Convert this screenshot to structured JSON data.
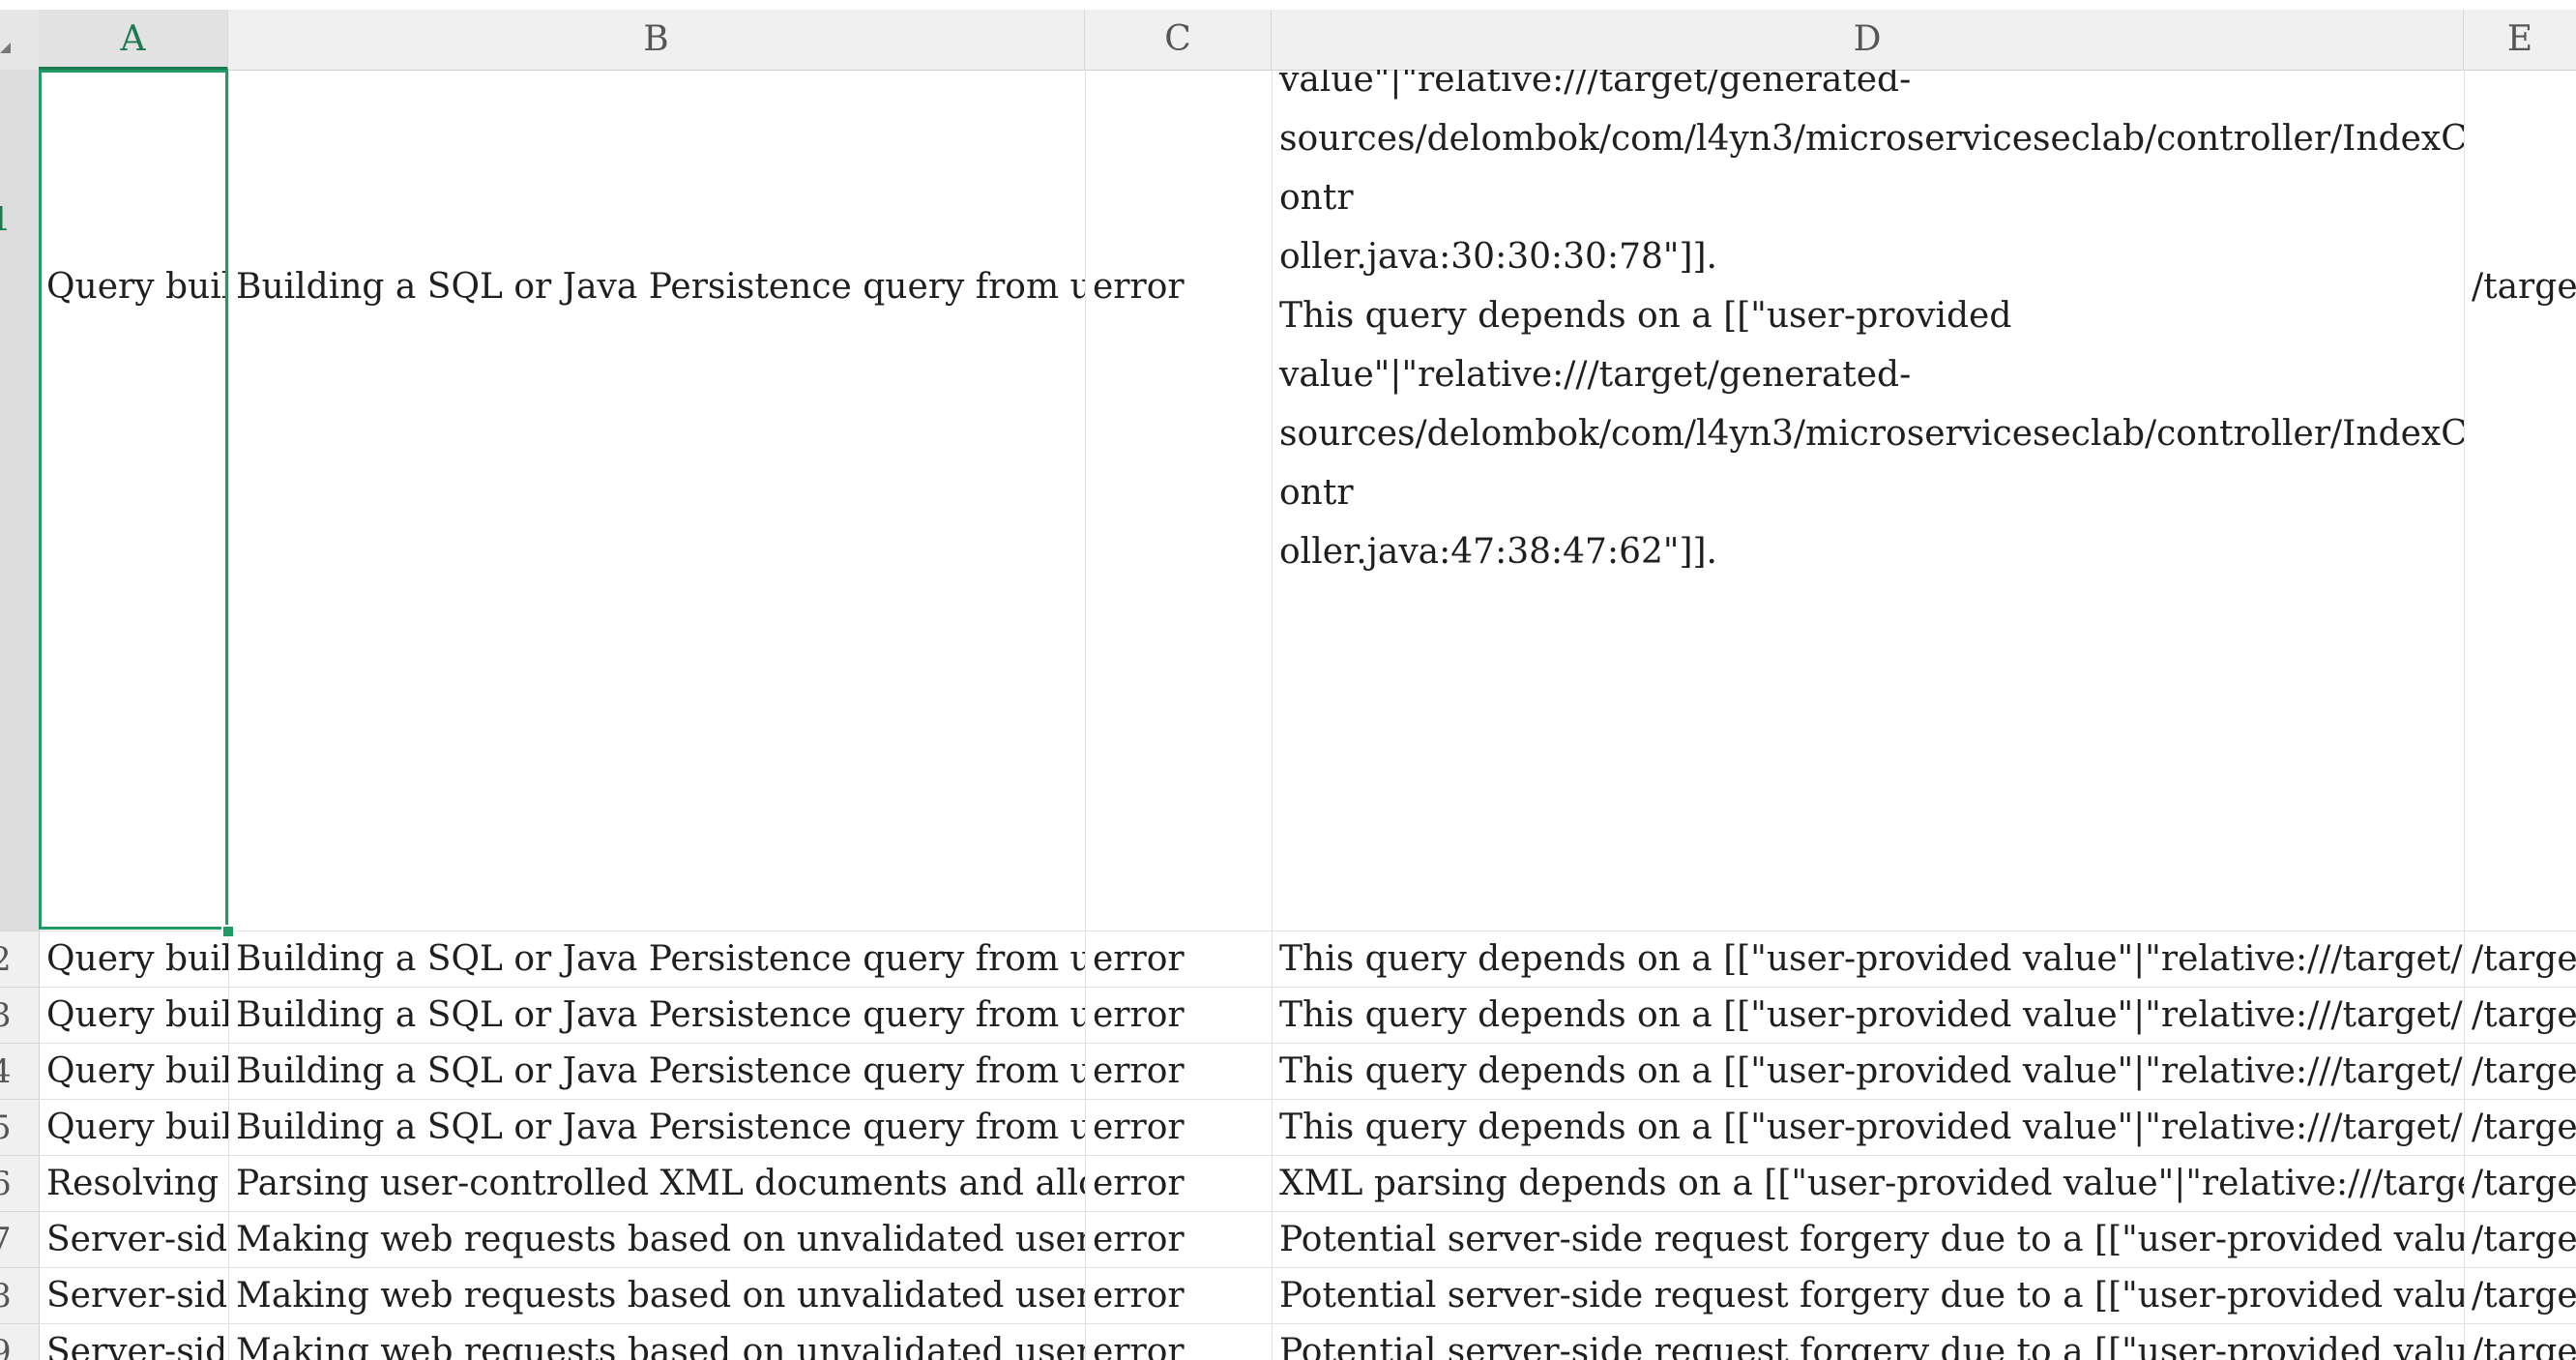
{
  "columns": [
    "A",
    "B",
    "C",
    "D",
    "E"
  ],
  "active_column": "A",
  "row_numbers": [
    "1",
    "2",
    "3",
    "4",
    "5",
    "6",
    "7",
    "8",
    "9"
  ],
  "rows": [
    {
      "a": "Query built",
      "b": "Building a SQL or Java Persistence query from user-co",
      "c": "error",
      "d": "value\"|\"relative:///target/generated-\nsources/delombok/com/l4yn3/microserviceseclab/controller/IndexContr\noller.java:30:30:30:78\"]].\nThis query depends on a [[\"user-provided\nvalue\"|\"relative:///target/generated-\nsources/delombok/com/l4yn3/microserviceseclab/controller/IndexContr\noller.java:47:38:47:62\"]].",
      "e": "/target"
    },
    {
      "a": "Query built",
      "b": "Building a SQL or Java Persistence query from user-co",
      "c": "error",
      "d": "This query depends on a [[\"user-provided value\"|\"relative:///target/gener",
      "e": "/target"
    },
    {
      "a": "Query built",
      "b": "Building a SQL or Java Persistence query from user-co",
      "c": "error",
      "d": "This query depends on a [[\"user-provided value\"|\"relative:///target/gener",
      "e": "/target"
    },
    {
      "a": "Query built",
      "b": "Building a SQL or Java Persistence query from user-co",
      "c": "error",
      "d": "This query depends on a [[\"user-provided value\"|\"relative:///target/gener",
      "e": "/target"
    },
    {
      "a": "Query built",
      "b": "Building a SQL or Java Persistence query from user-co",
      "c": "error",
      "d": "This query depends on a [[\"user-provided value\"|\"relative:///target/gener",
      "e": "/target"
    },
    {
      "a": "Resolving X",
      "b": "Parsing user-controlled XML documents and allowing",
      "c": "error",
      "d": "XML parsing depends on a [[\"user-provided value\"|\"relative:///target/ger",
      "e": "/target"
    },
    {
      "a": "Server-side",
      "b": "Making web requests based on unvalidated user-input",
      "c": "error",
      "d": "Potential server-side request forgery due to a [[\"user-provided value\"|\"rela",
      "e": "/target"
    },
    {
      "a": "Server-side",
      "b": "Making web requests based on unvalidated user-input",
      "c": "error",
      "d": "Potential server-side request forgery due to a [[\"user-provided value\"|\"rela",
      "e": "/target"
    },
    {
      "a": "Server-side",
      "b": "Making web requests based on unvalidated user-input",
      "c": "error",
      "d": "Potential server-side request forgery due to a [[\"user-provided value\"|\"rela",
      "e": "/target"
    }
  ],
  "colors": {
    "selection": "#1f9b63",
    "active_header_text": "#1d7a4e",
    "header_bg": "#f0f0f0",
    "gridline": "#e0e0e0"
  }
}
